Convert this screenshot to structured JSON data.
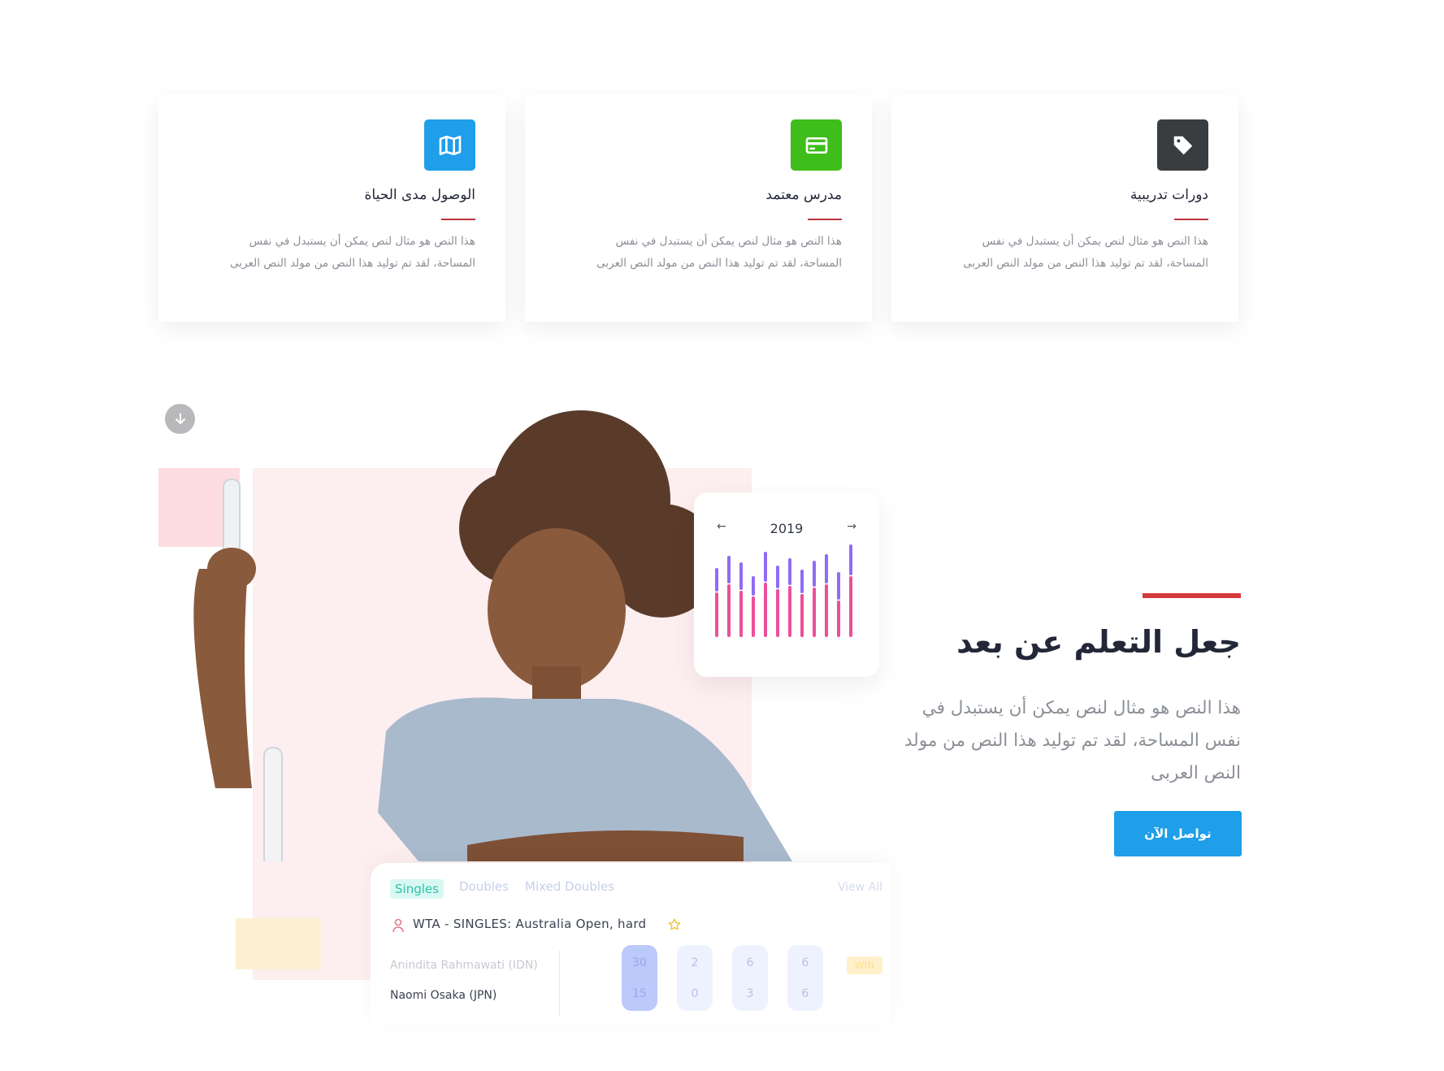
{
  "features": [
    {
      "title": "دورات تدريبية",
      "text": "هذا النص هو مثال لنص يمكن أن يستبدل في نفس المساحة، لقد تم توليد هذا النص من مولد النص العربى",
      "icon": "tag-icon",
      "icon_color": "#3a3d3f"
    },
    {
      "title": "مدرس معتمد",
      "text": "هذا النص هو مثال لنص يمكن أن يستبدل في نفس المساحة، لقد تم توليد هذا النص من مولد النص العربى",
      "icon": "credit-card-icon",
      "icon_color": "#3fbd1a"
    },
    {
      "title": "الوصول مدى الحياة",
      "text": "هذا النص هو مثال لنص يمكن أن يستبدل في نفس المساحة، لقد تم توليد هذا النص من مولد النص العربى",
      "icon": "map-icon",
      "icon_color": "#1f9ee9"
    }
  ],
  "hero": {
    "title": "جعل التعلم عن بعد",
    "text": "هذا النص هو مثال لنص يمكن أن يستبدل في نفس المساحة، لقد تم توليد هذا النص من مولد النص العربى",
    "cta_label": "تواصل الآن",
    "accent_color": "#d73a3c",
    "cta_color": "#1f9ee9"
  },
  "chart_widget": {
    "year": "2019",
    "prev": "←",
    "next": "→"
  },
  "score_widget": {
    "tabs": [
      "Singles",
      "Doubles",
      "Mixed Doubles"
    ],
    "view_all": "View All",
    "match_title": "WTA - SINGLES: Australia Open, hard",
    "player1": "Anindita Rahmawati (IDN)",
    "player2": "Naomi Osaka (JPN)",
    "sets": [
      {
        "p1": "30",
        "p2": "15"
      },
      {
        "p1": "2",
        "p2": "0"
      },
      {
        "p1": "6",
        "p2": "3"
      },
      {
        "p1": "6",
        "p2": "6"
      }
    ],
    "win_badge": "WIN"
  }
}
